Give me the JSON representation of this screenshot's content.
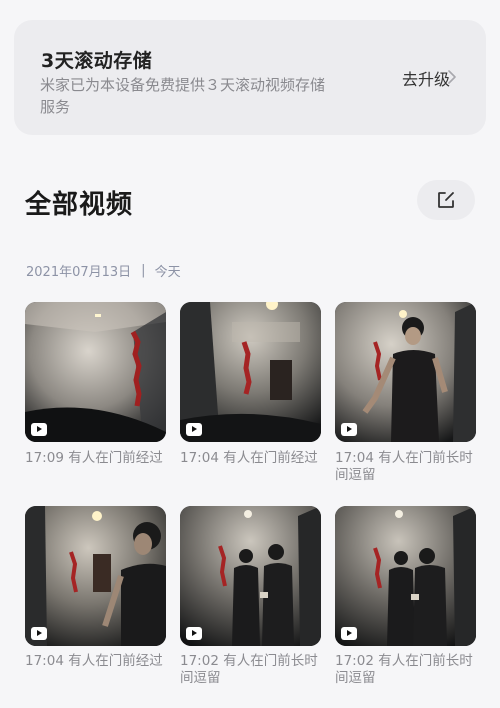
{
  "banner": {
    "title": "3天滚动存储",
    "description": "米家已为本设备免费提供３天滚动视频存储服务",
    "upgrade_label": "去升级"
  },
  "section": {
    "title": "全部视频"
  },
  "date_header": {
    "date": "2021年07月13日",
    "separator": "|",
    "relative": "今天"
  },
  "videos": [
    {
      "caption": "17:09 有人在门前经过"
    },
    {
      "caption": "17:04 有人在门前经过"
    },
    {
      "caption": "17:04 有人在门前长时间逗留"
    },
    {
      "caption": "17:04 有人在门前经过"
    },
    {
      "caption": "17:02 有人在门前长时间逗留"
    },
    {
      "caption": "17:02 有人在门前长时间逗留"
    }
  ]
}
